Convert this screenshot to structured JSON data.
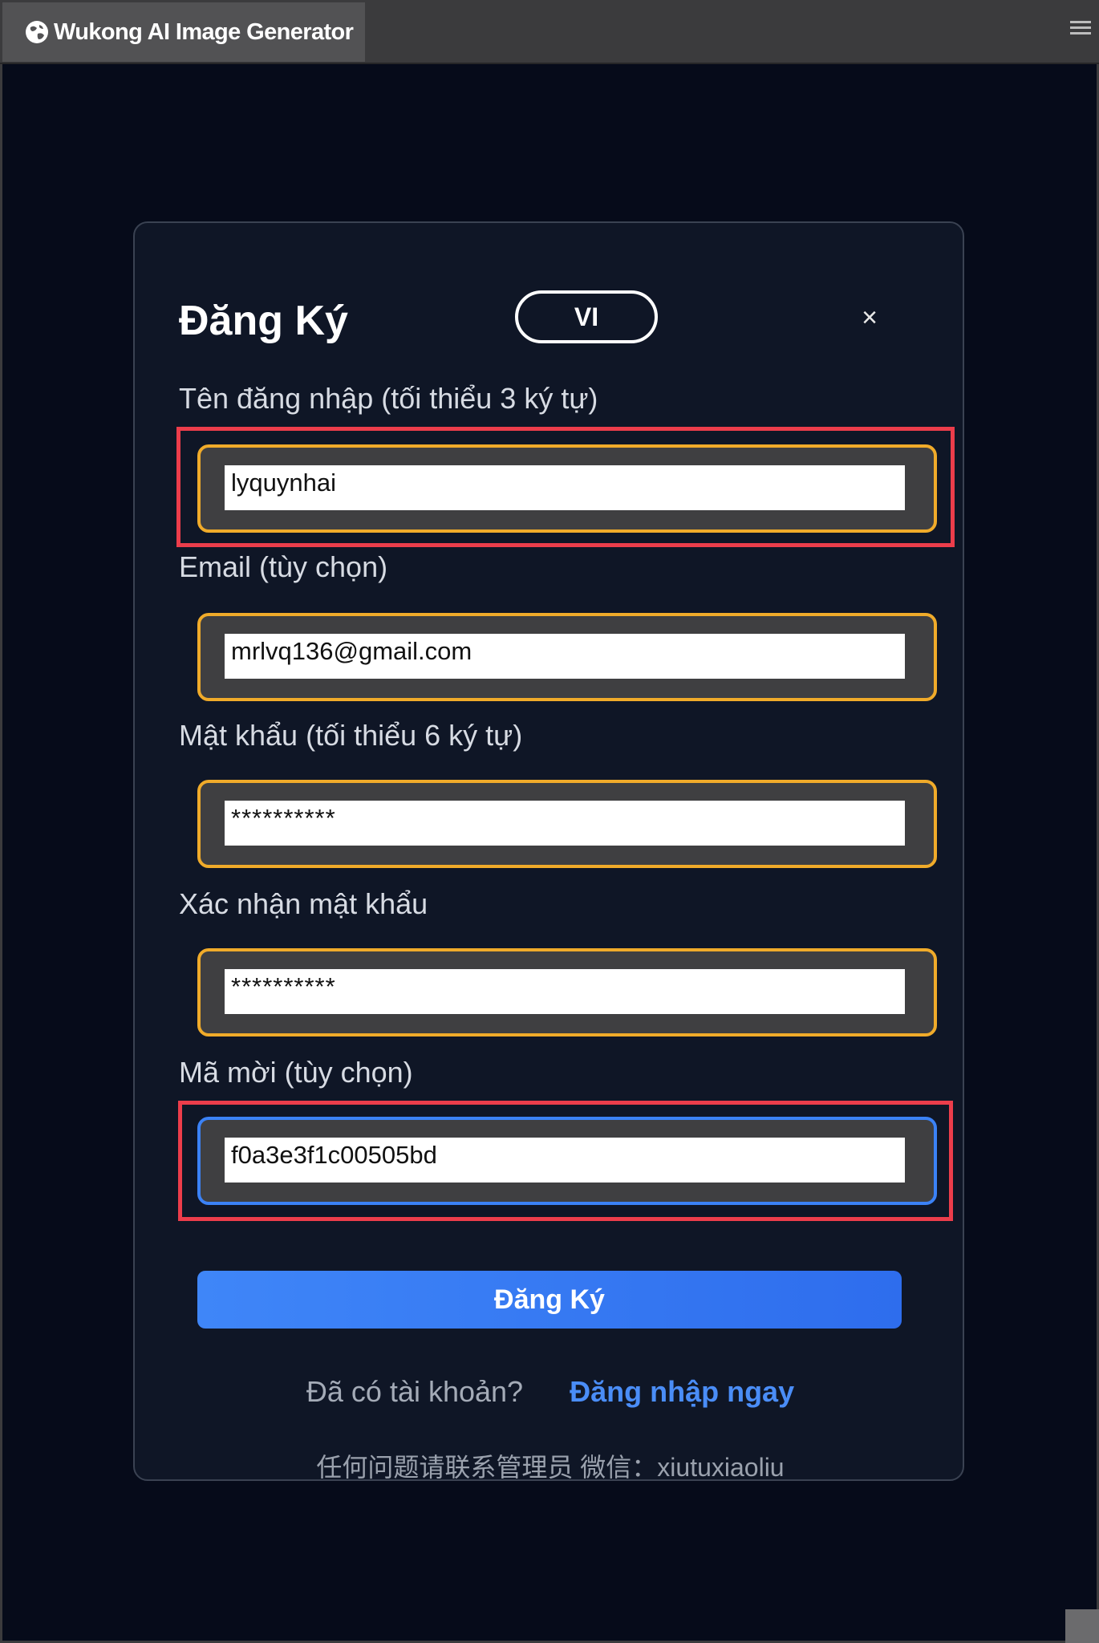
{
  "window": {
    "tab_title": "Wukong AI Image Generator",
    "tab_icon": "globe-icon",
    "menu_icon": "hamburger-menu-icon"
  },
  "dialog": {
    "title": "Đăng Ký",
    "language_button": "VI",
    "close_icon": "close-icon",
    "close_glyph": "×",
    "fields": [
      {
        "label": "Tên đăng nhập (tối thiểu 3 ký tự)",
        "value": "lyquynhai",
        "highlighted": true
      },
      {
        "label": "Email (tùy chọn)",
        "value": "mrlvq136@gmail.com",
        "highlighted": false
      },
      {
        "label": "Mật khẩu (tối thiểu 6 ký tự)",
        "value": "**********",
        "highlighted": false
      },
      {
        "label": "Xác nhận mật khẩu",
        "value": "**********",
        "highlighted": false
      },
      {
        "label": "Mã mời (tùy chọn)",
        "value": "f0a3e3f1c00505bd",
        "highlighted": true,
        "focused": true
      }
    ],
    "submit_label": "Đăng Ký",
    "login_prompt": "Đã có tài khoản?",
    "login_link": "Đăng nhập ngay",
    "contact_note": "任何问题请联系管理员 微信：xiutuxiaoliu"
  },
  "colors": {
    "background": "#060b1a",
    "dialog": "#0f1626",
    "field_border": "#f0ab2a",
    "field_border_focused": "#3b82f6",
    "highlight": "#ec3d4b",
    "primary": "#3f86f8",
    "link": "#4a8df7"
  }
}
